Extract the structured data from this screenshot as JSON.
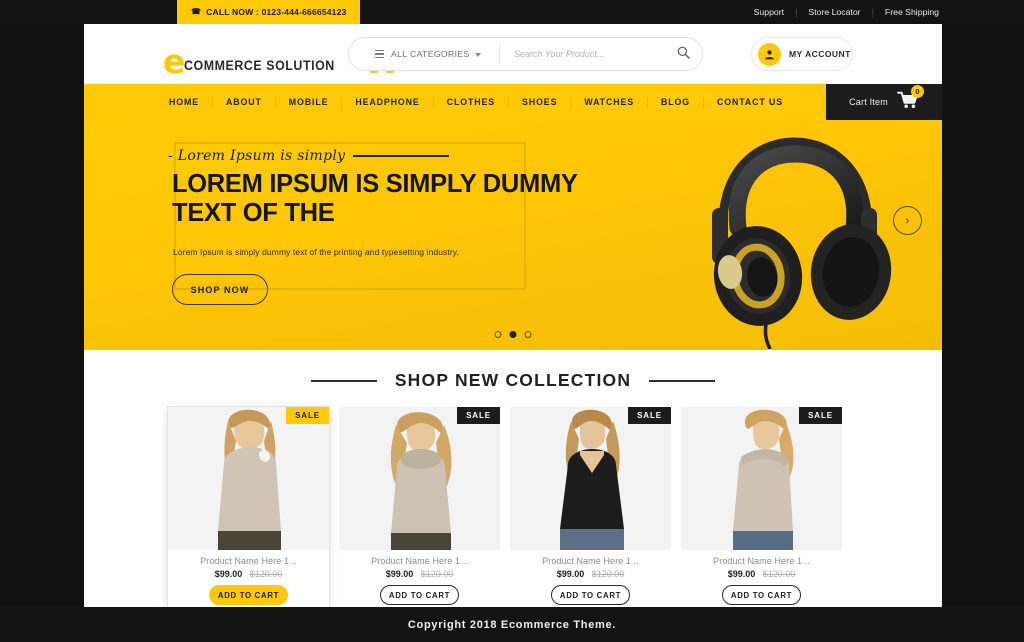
{
  "topbar": {
    "call_now": "CALL NOW : 0123-444-666654123",
    "phone_icon": "phone-icon",
    "links": [
      "Support",
      "Store Locator",
      "Free Shipping"
    ]
  },
  "header": {
    "logo_mark": "e",
    "logo_text": "COMMERCE SOLUTION",
    "cart_logo_icon": "shopping-cart-icon",
    "search": {
      "category_label": "ALL CATEGORIES",
      "placeholder": "Search Your Product...",
      "value": "",
      "search_icon": "search-icon",
      "menu_icon": "hamburger-icon",
      "caret_icon": "chevron-down-icon"
    },
    "account_label": "MY ACCOUNT",
    "account_icon": "user-icon"
  },
  "nav": {
    "items": [
      "HOME",
      "ABOUT",
      "MOBILE",
      "HEADPHONE",
      "CLOTHES",
      "SHOES",
      "WATCHES",
      "BLOG",
      "CONTACT US"
    ],
    "cart_label": "Cart Item",
    "cart_count": "0",
    "cart_icon": "cart-icon"
  },
  "hero": {
    "script_text": "- Lorem Ipsum is simply",
    "heading": "LOREM IPSUM IS SIMPLY DUMMY TEXT OF THE",
    "subtext": "Lorem Ipsum is simply dummy text of the printing and typesetting industry.",
    "cta": "SHOP NOW",
    "prev_icon": "chevron-left-icon",
    "next_icon": "chevron-right-icon",
    "product_image": "black-over-ear-headphones",
    "dots": 3,
    "active_dot": 1,
    "background_color": "#ffc907"
  },
  "shop": {
    "title": "SHOP NEW COLLECTION",
    "products": [
      {
        "badge": "SALE",
        "name": "Product Name Here 1 ..",
        "price": "$99.00",
        "old_price": "$120.00",
        "button": "ADD TO CART",
        "highlighted": true,
        "image": "woman-in-beige-cold-shoulder-top"
      },
      {
        "badge": "SALE",
        "name": "Product Name Here 1 ..",
        "price": "$99.00",
        "old_price": "$120.00",
        "button": "ADD TO CART",
        "highlighted": false,
        "image": "woman-in-beige-cowl-neck-sweater"
      },
      {
        "badge": "SALE",
        "name": "Product Name Here 1 ..",
        "price": "$99.00",
        "old_price": "$120.00",
        "button": "ADD TO CART",
        "highlighted": false,
        "image": "woman-in-black-lace-blouse"
      },
      {
        "badge": "SALE",
        "name": "Product Name Here 1 ..",
        "price": "$99.00",
        "old_price": "$120.00",
        "button": "ADD TO CART",
        "highlighted": false,
        "image": "woman-in-beige-off-shoulder-top"
      }
    ]
  },
  "footer": {
    "copyright": "Copyright 2018 Ecommerce Theme."
  },
  "colors": {
    "accent": "#ffc907",
    "dark": "#131313"
  }
}
